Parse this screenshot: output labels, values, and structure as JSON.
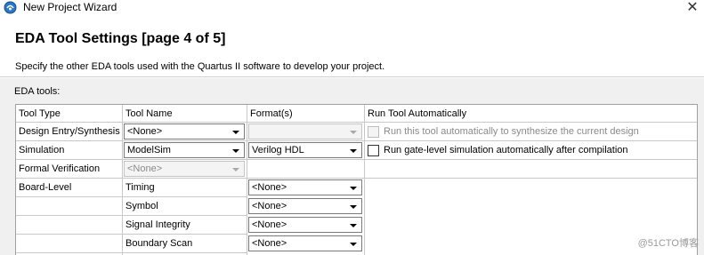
{
  "window": {
    "title": "New Project Wizard",
    "close_glyph": "✕",
    "icon": "quartus-wizard-icon"
  },
  "header": {
    "title": "EDA Tool Settings [page 4 of 5]",
    "description": "Specify the other EDA tools used with the Quartus II software to develop your project."
  },
  "section_label": "EDA tools:",
  "table": {
    "columns": [
      "Tool Type",
      "Tool Name",
      "Format(s)",
      "Run Tool Automatically"
    ],
    "rows": [
      {
        "type": "Design Entry/Synthesis",
        "tool": "<None>",
        "format": "",
        "run_label": "Run this tool automatically to synthesize the current design",
        "run_checked": false
      },
      {
        "type": "Simulation",
        "tool": "ModelSim",
        "format": "Verilog HDL",
        "run_label": "Run gate-level simulation automatically after compilation",
        "run_checked": false
      },
      {
        "type": "Formal Verification",
        "tool": "<None>"
      },
      {
        "type": "Board-Level",
        "tool": "Timing",
        "format": "<None>"
      },
      {
        "type": "",
        "tool": "Symbol",
        "format": "<None>"
      },
      {
        "type": "",
        "tool": "Signal Integrity",
        "format": "<None>"
      },
      {
        "type": "",
        "tool": "Boundary Scan",
        "format": "<None>"
      }
    ]
  },
  "watermark": "@51CTO博客"
}
